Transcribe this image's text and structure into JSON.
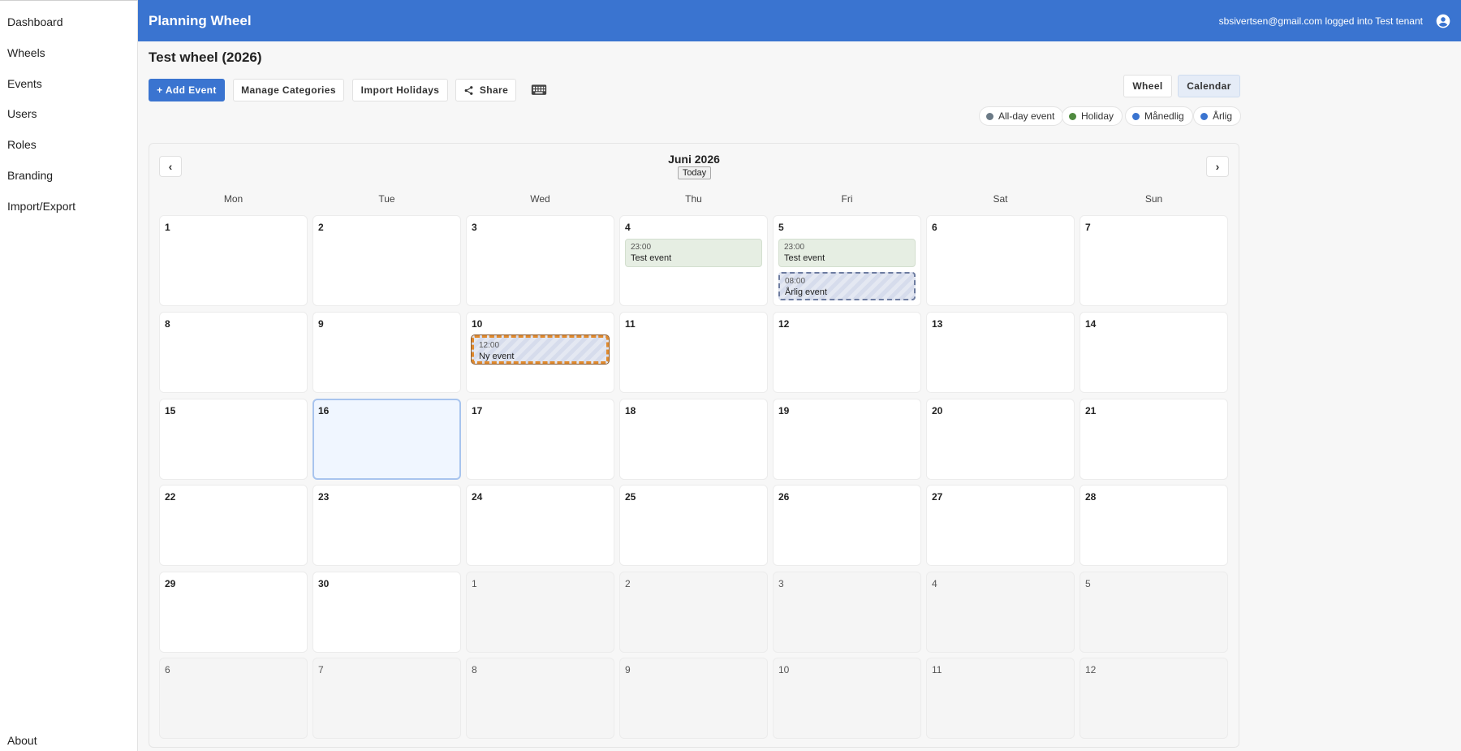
{
  "sidebar": {
    "items": [
      {
        "label": "Dashboard"
      },
      {
        "label": "Wheels"
      },
      {
        "label": "Events"
      },
      {
        "label": "Users"
      },
      {
        "label": "Roles"
      },
      {
        "label": "Branding"
      },
      {
        "label": "Import/Export"
      }
    ],
    "footer_label": "About"
  },
  "header": {
    "app_title": "Planning Wheel",
    "login_status": "sbsivertsen@gmail.com logged into Test tenant",
    "account_icon": "account-circle-icon"
  },
  "page": {
    "title": "Test wheel (2026)"
  },
  "toolbar": {
    "add_event": "+ Add Event",
    "manage_categories": "Manage Categories",
    "import_holidays": "Import Holidays",
    "share": "Share",
    "share_icon": "share-icon",
    "keyboard_icon": "keyboard-icon"
  },
  "view_toggle": {
    "wheel": "Wheel",
    "calendar": "Calendar",
    "selected": "Calendar"
  },
  "legend": [
    {
      "label": "All-day event",
      "color": "#6b7a86"
    },
    {
      "label": "Holiday",
      "color": "#4f8a3f"
    },
    {
      "label": "Månedlig",
      "color": "#3a74d0"
    },
    {
      "label": "Årlig",
      "color": "#3a74d0"
    }
  ],
  "calendar": {
    "month_label": "Juni 2026",
    "today_label": "Today",
    "prev_label": "‹",
    "next_label": "›",
    "weekdays": [
      "Mon",
      "Tue",
      "Wed",
      "Thu",
      "Fri",
      "Sat",
      "Sun"
    ],
    "weeks": [
      [
        "1",
        "2",
        "3",
        "4",
        "5",
        "6",
        "7"
      ],
      [
        "8",
        "9",
        "10",
        "11",
        "12",
        "13",
        "14"
      ],
      [
        "15",
        "16",
        "17",
        "18",
        "19",
        "20",
        "21"
      ],
      [
        "22",
        "23",
        "24",
        "25",
        "26",
        "27",
        "28"
      ],
      [
        "29",
        "30",
        "1",
        "2",
        "3",
        "4",
        "5"
      ],
      [
        "6",
        "7",
        "8",
        "9",
        "10",
        "11",
        "12"
      ]
    ],
    "today_date": "16",
    "events": {
      "thu_4": {
        "time": "23:00",
        "title": "Test event"
      },
      "fri_5_a": {
        "time": "23:00",
        "title": "Test event"
      },
      "fri_5_b": {
        "time": "08:00",
        "title": "Årlig event"
      },
      "wed_10": {
        "time": "12:00",
        "title": "Ny event"
      }
    }
  }
}
